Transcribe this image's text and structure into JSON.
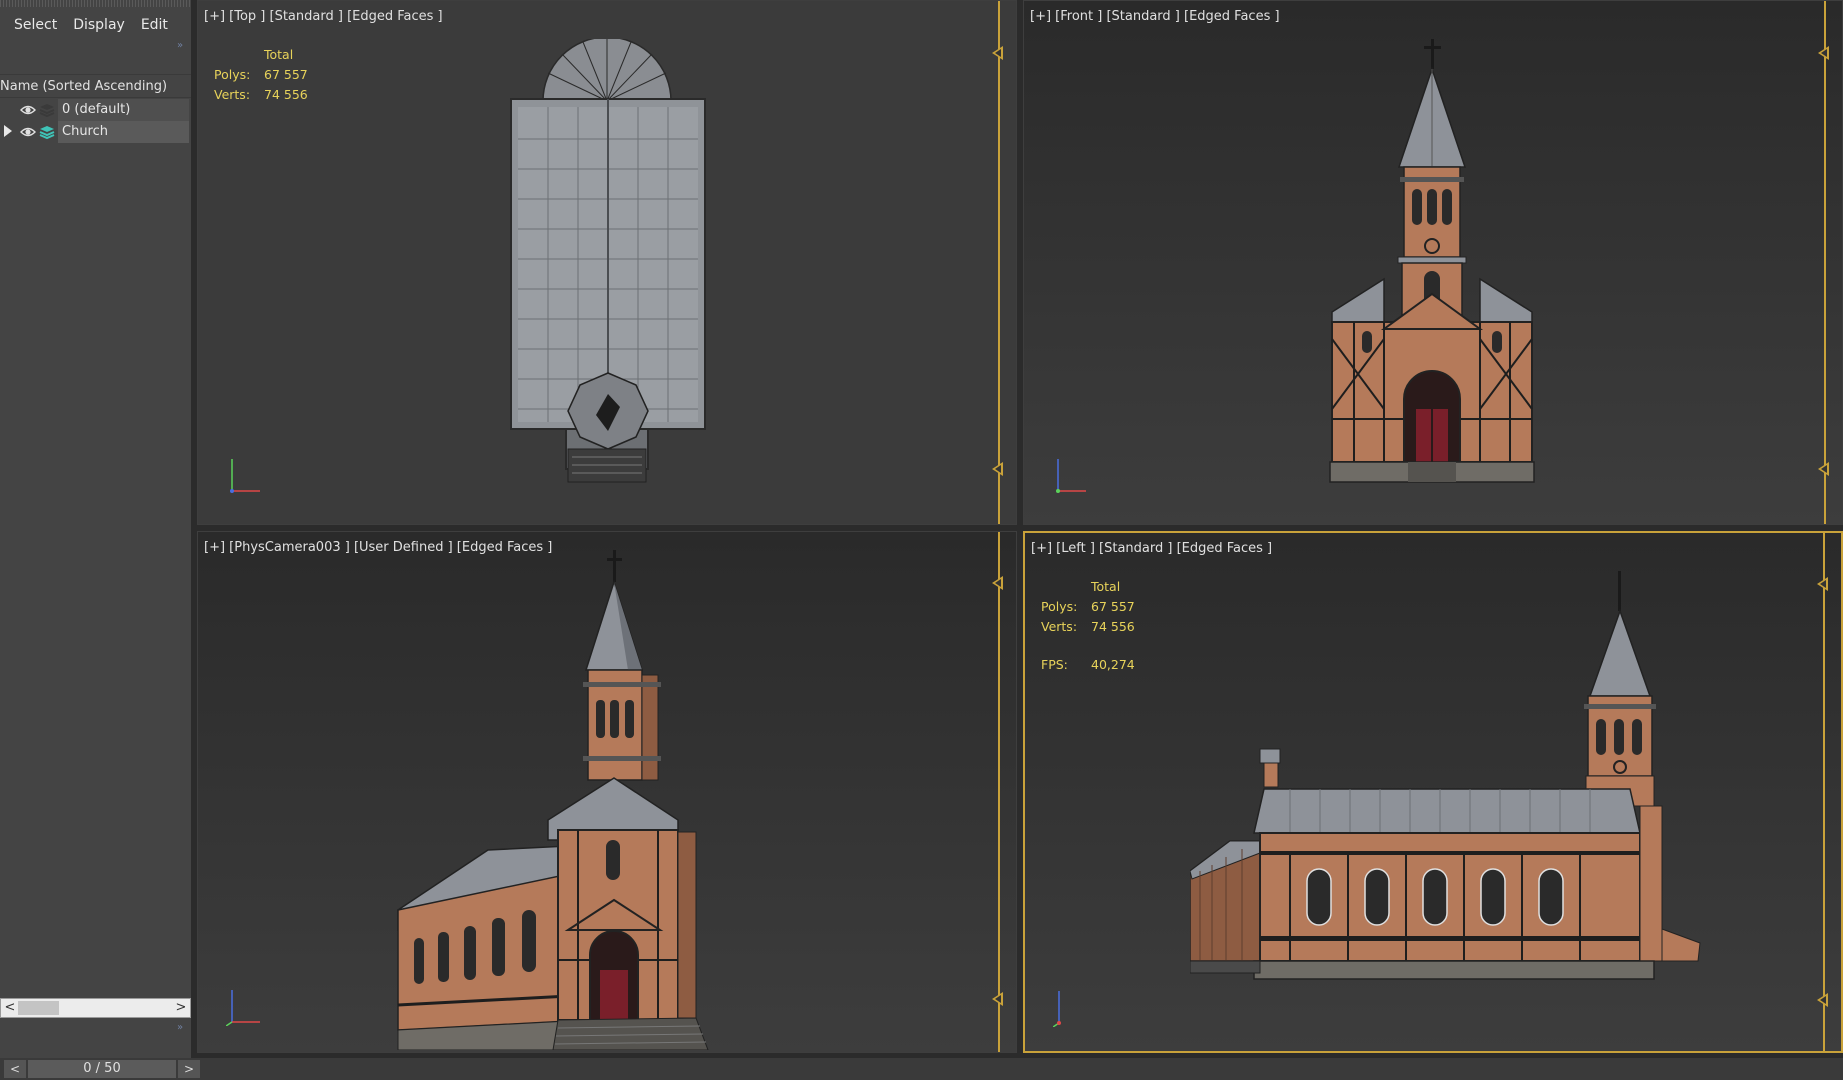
{
  "explorer": {
    "menu": [
      "Select",
      "Display",
      "Edit"
    ],
    "column_header": "Name (Sorted Ascending)",
    "rows": [
      {
        "label": "0 (default)"
      },
      {
        "label": "Church"
      }
    ]
  },
  "timeline": {
    "prev": "<",
    "next": ">",
    "frame": "0 / 50"
  },
  "viewports": {
    "top": {
      "label": "[+] [Top ] [Standard ] [Edged Faces ]",
      "stats": {
        "total": "Total",
        "polys_key": "Polys:",
        "polys": "67 557",
        "verts_key": "Verts:",
        "verts": "74 556"
      }
    },
    "front": {
      "label": "[+] [Front ] [Standard ] [Edged Faces ]"
    },
    "camera": {
      "label": "[+] [PhysCamera003 ] [User Defined ] [Edged Faces ]"
    },
    "left": {
      "label": "[+] [Left ] [Standard ] [Edged Faces ]",
      "stats": {
        "total": "Total",
        "polys_key": "Polys:",
        "polys": "67 557",
        "verts_key": "Verts:",
        "verts": "74 556",
        "fps_key": "FPS:",
        "fps": "40,274"
      }
    }
  },
  "colors": {
    "accent": "#c9a23a",
    "stats_text": "#e8d35a",
    "brick": "#b57a5a",
    "roof": "#8e9299"
  }
}
